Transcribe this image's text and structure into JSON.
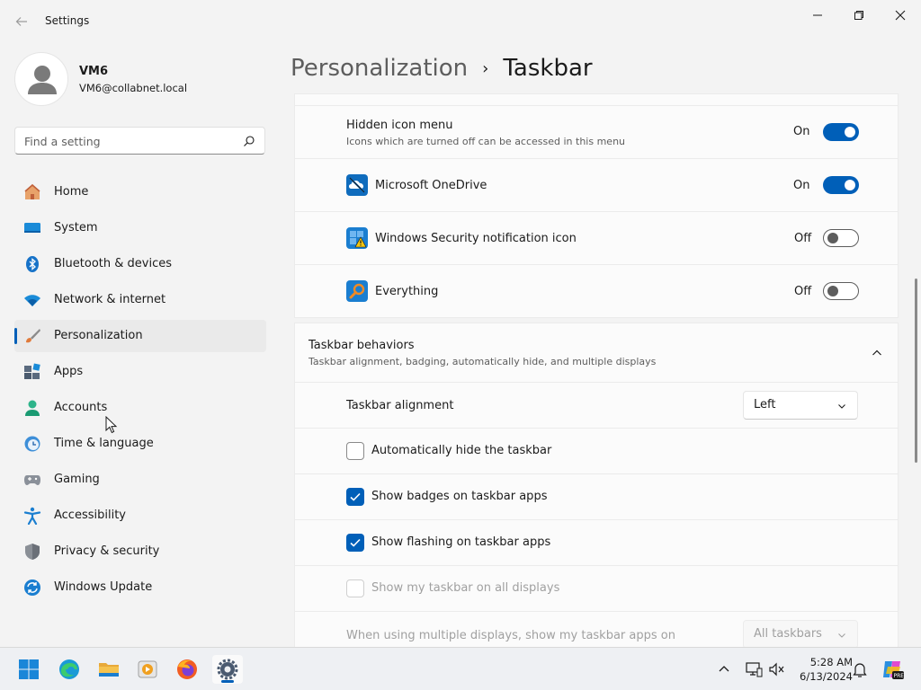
{
  "window": {
    "app_title": "Settings"
  },
  "profile": {
    "name": "VM6",
    "email": "VM6@collabnet.local"
  },
  "search": {
    "placeholder": "Find a setting"
  },
  "sidebar": {
    "items": [
      {
        "label": "Home",
        "icon": "home-icon"
      },
      {
        "label": "System",
        "icon": "system-icon"
      },
      {
        "label": "Bluetooth & devices",
        "icon": "bluetooth-icon"
      },
      {
        "label": "Network & internet",
        "icon": "wifi-icon"
      },
      {
        "label": "Personalization",
        "icon": "brush-icon",
        "active": true
      },
      {
        "label": "Apps",
        "icon": "apps-icon"
      },
      {
        "label": "Accounts",
        "icon": "accounts-icon"
      },
      {
        "label": "Time & language",
        "icon": "clock-globe-icon"
      },
      {
        "label": "Gaming",
        "icon": "gamepad-icon"
      },
      {
        "label": "Accessibility",
        "icon": "accessibility-icon"
      },
      {
        "label": "Privacy & security",
        "icon": "shield-icon"
      },
      {
        "label": "Windows Update",
        "icon": "update-icon"
      }
    ]
  },
  "breadcrumb": {
    "parent": "Personalization",
    "separator": "›",
    "current": "Taskbar"
  },
  "corner_icons": {
    "hidden_icon_menu": {
      "title": "Hidden icon menu",
      "subtitle": "Icons which are turned off can be accessed in this menu",
      "state": "On"
    },
    "items": [
      {
        "label": "Microsoft OneDrive",
        "state": "On",
        "icon": "onedrive-icon"
      },
      {
        "label": "Windows Security notification icon",
        "state": "Off",
        "icon": "windows-security-icon"
      },
      {
        "label": "Everything",
        "state": "Off",
        "icon": "everything-search-icon"
      }
    ]
  },
  "taskbar_behaviors": {
    "title": "Taskbar behaviors",
    "subtitle": "Taskbar alignment, badging, automatically hide, and multiple displays",
    "alignment_label": "Taskbar alignment",
    "alignment_value": "Left",
    "checkboxes": [
      {
        "label": "Automatically hide the taskbar",
        "checked": false,
        "enabled": true
      },
      {
        "label": "Show badges on taskbar apps",
        "checked": true,
        "enabled": true
      },
      {
        "label": "Show flashing on taskbar apps",
        "checked": true,
        "enabled": true
      },
      {
        "label": "Show my taskbar on all displays",
        "checked": false,
        "enabled": false
      }
    ],
    "multi_display_label": "When using multiple displays, show my taskbar apps on",
    "multi_display_value": "All taskbars"
  },
  "taskbar": {
    "time": "5:28 AM",
    "date": "6/13/2024"
  },
  "colors": {
    "accent": "#005fb8",
    "background": "#f3f3f3",
    "card": "#fbfbfb"
  }
}
